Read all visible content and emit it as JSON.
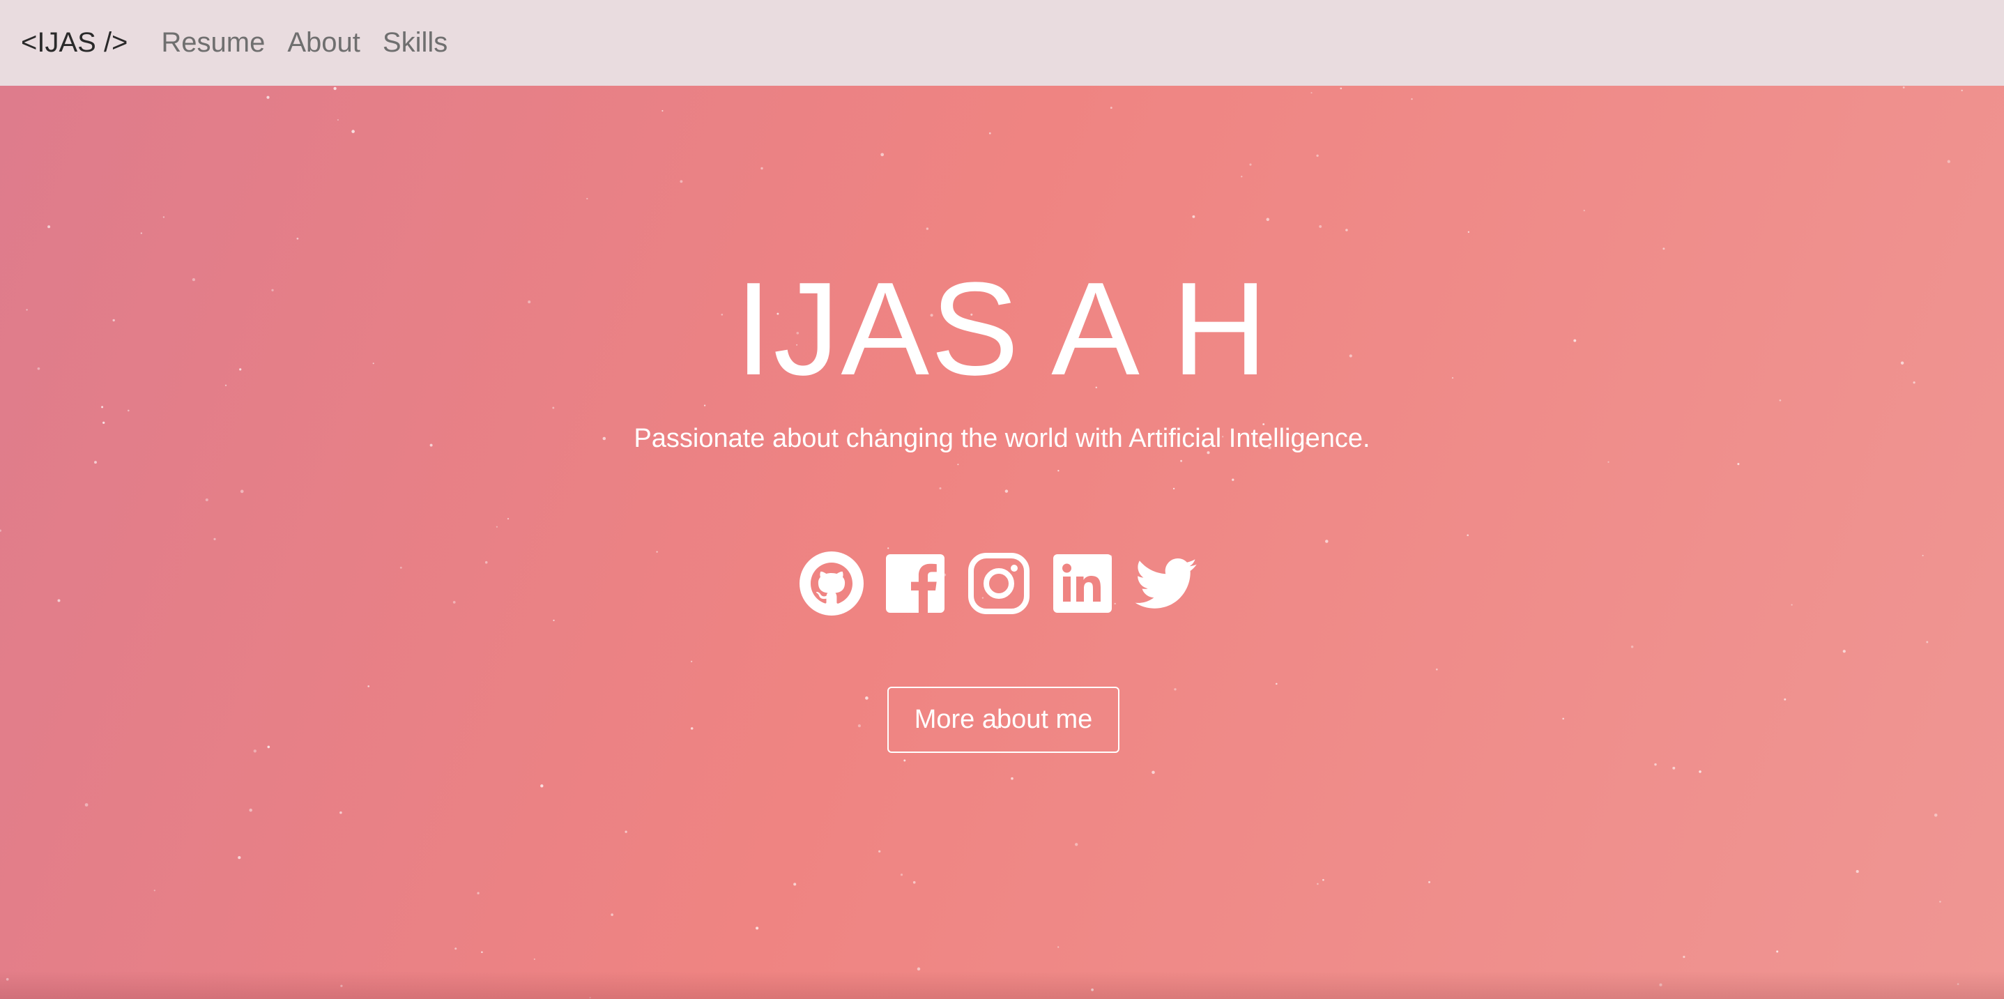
{
  "navbar": {
    "brand": "<IJAS />",
    "links": [
      "Resume",
      "About",
      "Skills"
    ]
  },
  "hero": {
    "name": "IJAS A H",
    "tagline": "Passionate about changing the world with Artificial Intelligence.",
    "socials": [
      "github-icon",
      "facebook-icon",
      "instagram-icon",
      "linkedin-icon",
      "twitter-icon"
    ],
    "button_label": "More about me"
  },
  "colors": {
    "navbar_bg": "#e9dcdf",
    "hero_gradient_start": "#de7c8c",
    "hero_gradient_mid": "#ef8482",
    "hero_gradient_end": "#ef9693",
    "text_light": "#ffffff"
  }
}
